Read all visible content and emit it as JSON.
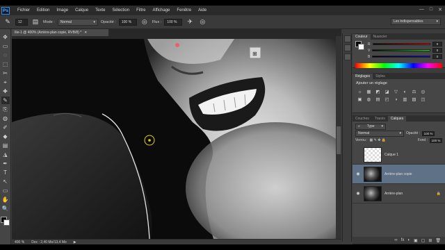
{
  "app": {
    "logo": "Ps",
    "window_controls": [
      "—",
      "□",
      "✕"
    ]
  },
  "menu": [
    "Fichier",
    "Edition",
    "Image",
    "Calque",
    "Texte",
    "Sélection",
    "Filtre",
    "Affichage",
    "Fenêtre",
    "Aide"
  ],
  "options": {
    "brush_size": "12",
    "mode_label": "Mode :",
    "mode_value": "Normal",
    "opacity_label": "Opacité :",
    "opacity_value": "100 %",
    "flow_label": "Flux :",
    "flow_value": "100 %",
    "workspace": "Les indispensables"
  },
  "document": {
    "tab_title": "Ilie-1 @ 400% (Arrière-plan copie, RVB/8) *",
    "zoom": "400 %",
    "doc_info": "Doc : 2,40 Mo/13,4 Mo"
  },
  "color_panel": {
    "tabs": [
      "Couleur",
      "Nuancier"
    ],
    "channels": [
      {
        "label": "R",
        "value": "0",
        "gradient": "linear-gradient(90deg,#000,#f00)"
      },
      {
        "label": "V",
        "value": "0",
        "gradient": "linear-gradient(90deg,#000,#0f0)"
      },
      {
        "label": "B",
        "value": "0",
        "gradient": "linear-gradient(90deg,#000,#00f)"
      }
    ]
  },
  "adjustments_panel": {
    "tabs": [
      "Réglages",
      "Styles"
    ],
    "title": "Ajouter un réglage",
    "icons": [
      "☼",
      "▦",
      "◩",
      "◪",
      "▽",
      "◐",
      "⚖",
      "◎",
      "▣",
      "◍",
      "▤",
      "◰",
      "◑",
      "▥",
      "▨",
      "◫"
    ]
  },
  "layers_panel": {
    "tabs": [
      "Couches",
      "Tracés",
      "Calques"
    ],
    "filter_label": "Type",
    "blend_mode": "Normal",
    "opacity_label": "Opacité :",
    "opacity_value": "100 %",
    "lock_label": "Verrou :",
    "fill_label": "Fond :",
    "fill_value": "100 %",
    "layers": [
      {
        "name": "Calque 1",
        "visible": false,
        "selected": false,
        "thumb": "checker"
      },
      {
        "name": "Arrière-plan copie",
        "visible": true,
        "selected": true,
        "thumb": "photo"
      },
      {
        "name": "Arrière-plan",
        "visible": true,
        "selected": false,
        "thumb": "photo",
        "locked": true
      }
    ],
    "footer_icons": [
      "∞",
      "fx",
      "◐",
      "▣",
      "▢",
      "⊞",
      "🗑"
    ]
  },
  "toolbar": [
    "✥",
    "▭",
    "◌",
    "⬚",
    "✂",
    "⌖",
    "✚",
    "✎",
    "⎘",
    "◍",
    "✐",
    "◆",
    "▤",
    "◮",
    "✒",
    "T",
    "↖",
    "▭",
    "✋",
    "🔍"
  ],
  "colors": {
    "accent_selected": "#5f7187",
    "brush_cursor": "#e6d020"
  }
}
